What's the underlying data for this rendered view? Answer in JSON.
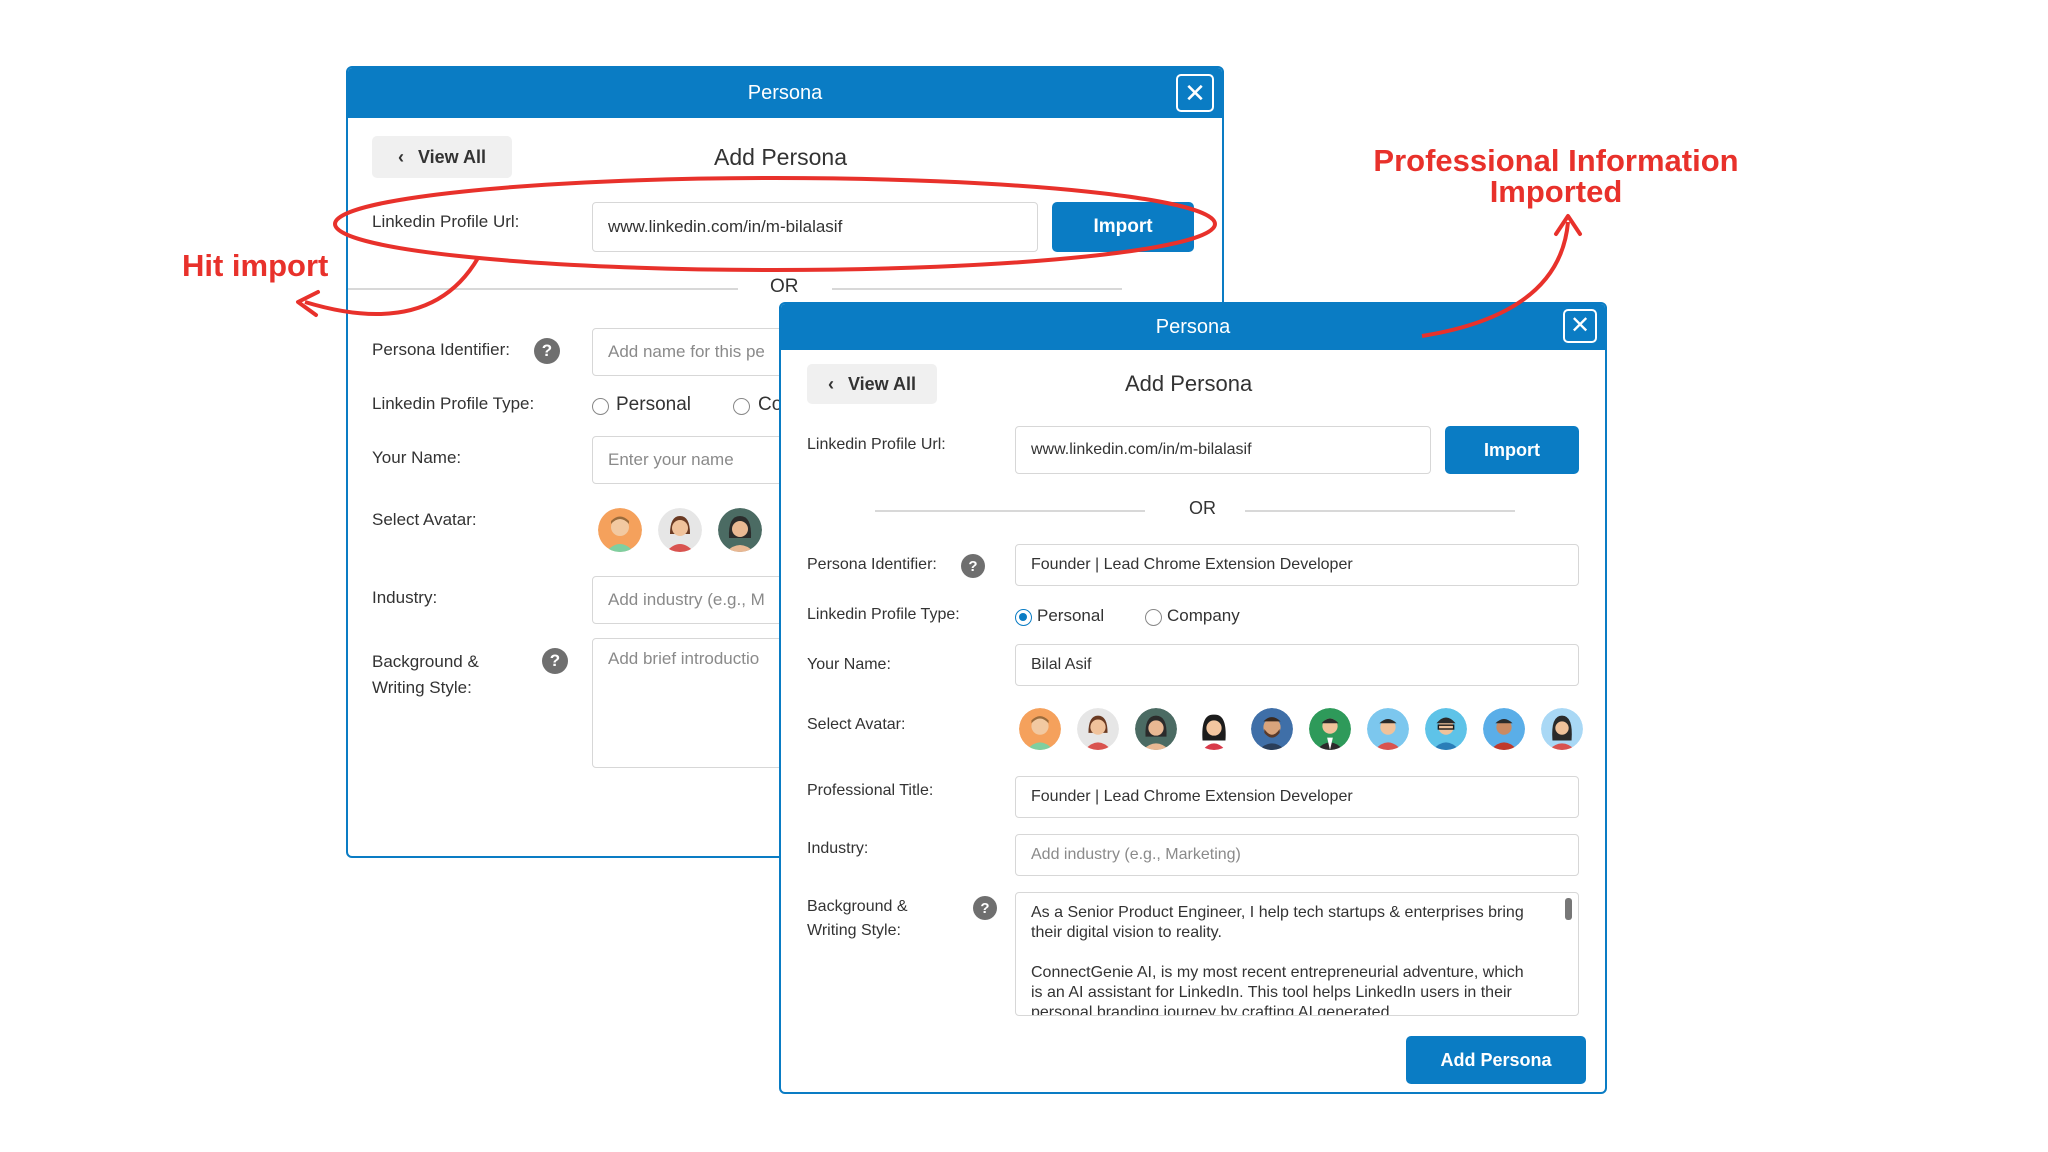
{
  "annotations": {
    "hit_import": "Hit import",
    "imported_line1": "Professional Information",
    "imported_line2": "Imported",
    "color": "#e8312b"
  },
  "dialog_back": {
    "title": "Persona",
    "view_all": "View All",
    "heading": "Add Persona",
    "url_label": "Linkedin Profile Url:",
    "url_value": "www.linkedin.com/in/m-bilalasif",
    "import_label": "Import",
    "or_text": "OR",
    "identifier_label": "Persona Identifier:",
    "identifier_placeholder": "Add name for this pe",
    "type_label": "Linkedin Profile Type:",
    "type_personal": "Personal",
    "type_company": "Co",
    "name_label": "Your Name:",
    "name_placeholder": "Enter your name",
    "avatar_label": "Select Avatar:",
    "industry_label": "Industry:",
    "industry_placeholder": "Add industry (e.g., M",
    "background_label_1": "Background &",
    "background_label_2": "Writing Style:",
    "background_placeholder": "Add brief introductio"
  },
  "dialog_front": {
    "title": "Persona",
    "view_all": "View All",
    "heading": "Add Persona",
    "url_label": "Linkedin Profile Url:",
    "url_value": "www.linkedin.com/in/m-bilalasif",
    "import_label": "Import",
    "or_text": "OR",
    "identifier_label": "Persona Identifier:",
    "identifier_value": "Founder | Lead Chrome Extension Developer",
    "type_label": "Linkedin Profile Type:",
    "type_personal": "Personal",
    "type_company": "Company",
    "type_selected": "Personal",
    "name_label": "Your Name:",
    "name_value": "Bilal Asif",
    "avatar_label": "Select Avatar:",
    "title_label": "Professional Title:",
    "title_value": "Founder | Lead Chrome Extension Developer",
    "industry_label": "Industry:",
    "industry_placeholder": "Add industry (e.g., Marketing)",
    "background_label_1": "Background &",
    "background_label_2": "Writing Style:",
    "background_para1": "As a Senior Product Engineer, I help tech startups & enterprises bring their digital vision to reality.",
    "background_para2": "ConnectGenie AI, is my most recent entrepreneurial adventure, which is an AI assistant for LinkedIn. This tool helps LinkedIn users in their personal branding journey by crafting AI generated",
    "add_button": "Add Persona"
  },
  "colors": {
    "primary": "#0a7cc4",
    "annotation": "#e8312b"
  }
}
